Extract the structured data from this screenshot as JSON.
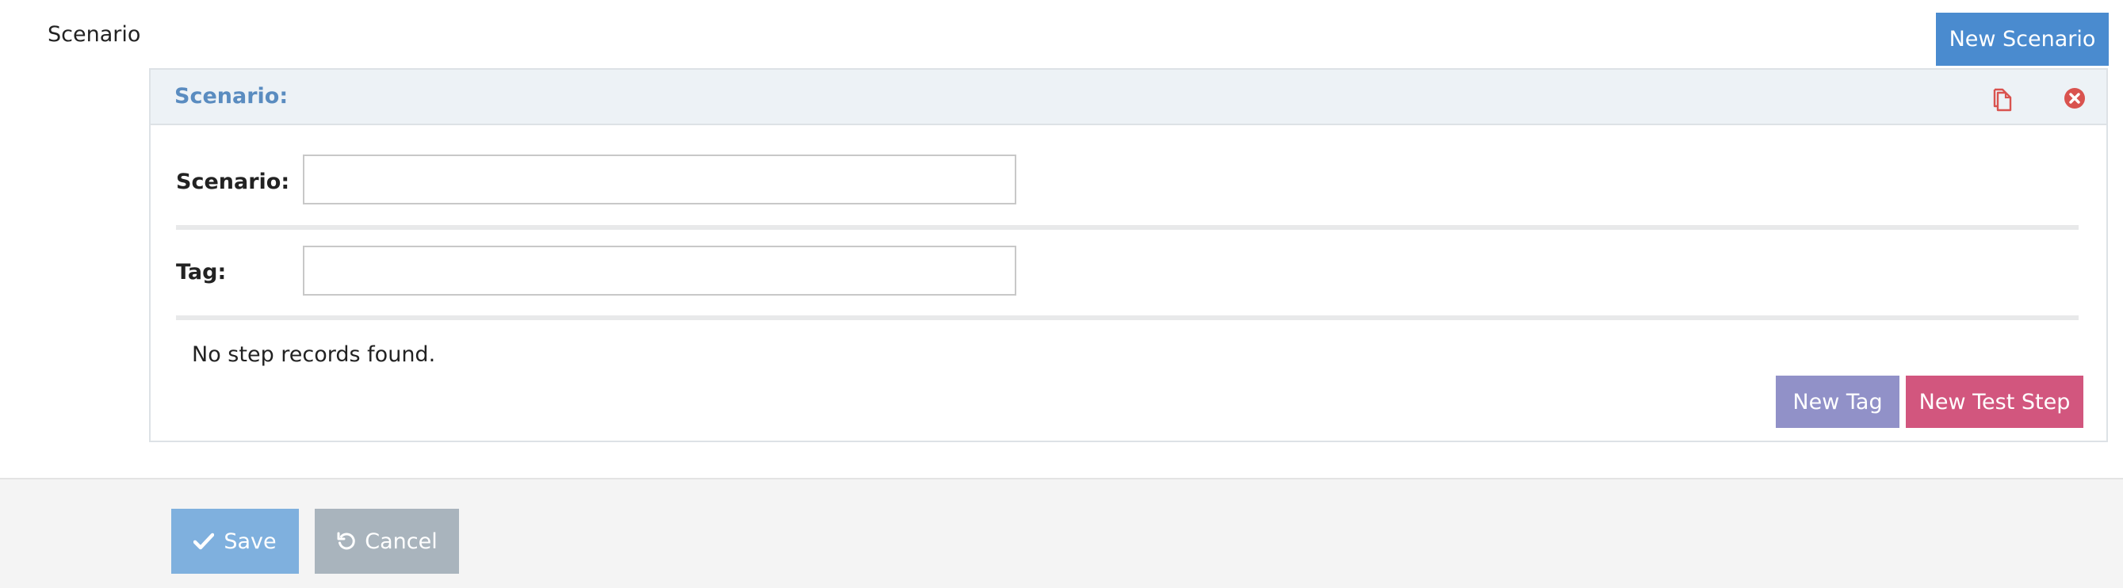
{
  "page": {
    "title": "Scenario"
  },
  "toolbar": {
    "new_scenario_label": "New Scenario"
  },
  "panel": {
    "title": "Scenario:",
    "icons": {
      "copy": "copy-icon",
      "close": "close-circle-icon"
    },
    "fields": {
      "scenario": {
        "label": "Scenario:",
        "value": "",
        "placeholder": ""
      },
      "tag": {
        "label": "Tag:",
        "value": "",
        "placeholder": ""
      }
    },
    "empty_message": "No step records found.",
    "new_tag_label": "New Tag",
    "new_test_step_label": "New Test Step"
  },
  "footer": {
    "save_label": "Save",
    "cancel_label": "Cancel"
  },
  "colors": {
    "primary": "#4a8bcf",
    "new_tag": "#9191c8",
    "new_test_step": "#d2567e",
    "save": "#7fb0de",
    "cancel": "#a9b4bd",
    "danger_icon": "#d9534f"
  }
}
